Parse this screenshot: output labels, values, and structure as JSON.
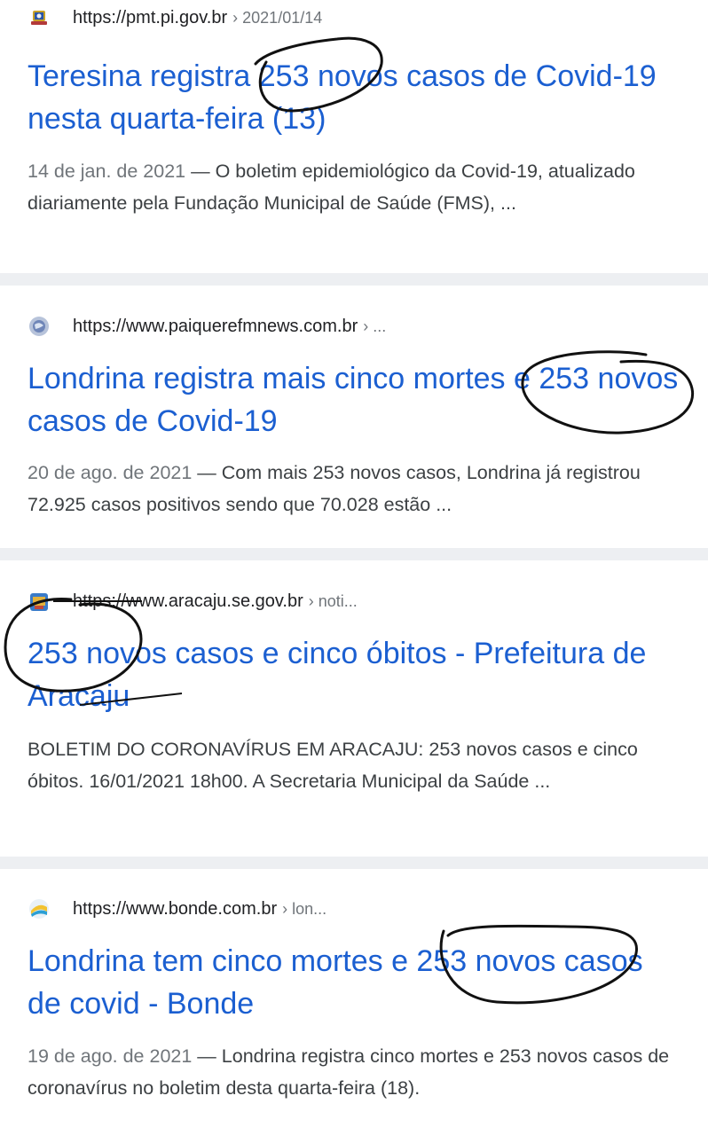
{
  "colors": {
    "title_link": "#1b5fd1",
    "separator": "#edeff2",
    "snippet_text": "#3c4043",
    "date_text": "#70757a",
    "marker_ink": "#111111"
  },
  "results": [
    {
      "favicon": "city-crest-icon",
      "url": "https://pmt.pi.gov.br",
      "crumb": "› 2021/01/14",
      "title": "Teresina registra 253 novos casos de Covid-19 nesta quarta-feira (13)",
      "date": "14 de jan. de 2021",
      "snippet": "O boletim epidemiológico da Covid-19, atualizado diariamente pela Fundação Municipal de Saúde (FMS), ..."
    },
    {
      "favicon": "globe-icon",
      "url": "https://www.paiquerefmnews.com.br",
      "crumb": "› ...",
      "title": "Londrina registra mais cinco mortes e 253 novos casos de Covid-19",
      "date": "20 de ago. de 2021",
      "snippet": "Com mais 253 novos casos, Londrina já registrou 72.925 casos positivos sendo que 70.028 estão ..."
    },
    {
      "favicon": "city-crest-icon",
      "url": "https://www.aracaju.se.gov.br",
      "crumb": "› noti...",
      "title": "253 novos casos e cinco óbitos - Prefeitura de Aracaju",
      "date": "",
      "snippet": "BOLETIM DO CORONAVÍRUS EM ARACAJU: 253 novos casos e cinco óbitos. 16/01/2021 18h00. A Secretaria Municipal da Saúde ..."
    },
    {
      "favicon": "bonde-logo-icon",
      "url": "https://www.bonde.com.br",
      "crumb": "› lon...",
      "title": "Londrina tem cinco mortes e 253 novos casos de covid - Bonde",
      "date": "19 de ago. de 2021",
      "snippet": "Londrina registra cinco mortes e 253 novos casos de coronavírus no boletim desta quarta-feira (18)."
    }
  ],
  "date_separator": "—"
}
